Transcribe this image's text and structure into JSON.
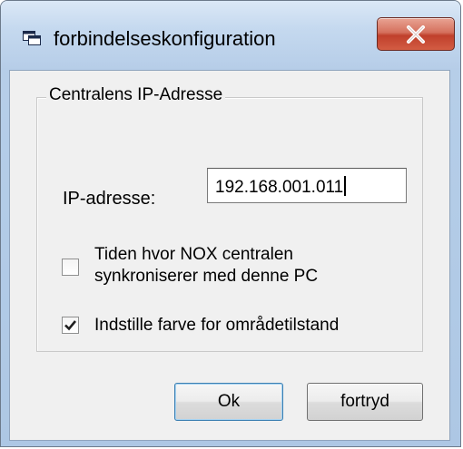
{
  "window": {
    "title": "forbindelseskonfiguration",
    "icon": "window-app-icon",
    "close_icon": "close-x-icon"
  },
  "group": {
    "legend": "Centralens IP-Adresse"
  },
  "ip": {
    "label": "IP-adresse:",
    "value": "192.168.001.011"
  },
  "checkboxes": [
    {
      "label_line1": "Tiden hvor NOX centralen",
      "label_line2": "synkroniserer med denne PC",
      "checked": false
    },
    {
      "label_line1": "Indstille farve for områdetilstand",
      "checked": true
    }
  ],
  "buttons": {
    "ok_label": "Ok",
    "cancel_label": "fortryd"
  },
  "colors": {
    "close_button": "#c8452f",
    "dialog_face": "#f0f0f0",
    "title_gradient_top": "#dbe8f6"
  }
}
